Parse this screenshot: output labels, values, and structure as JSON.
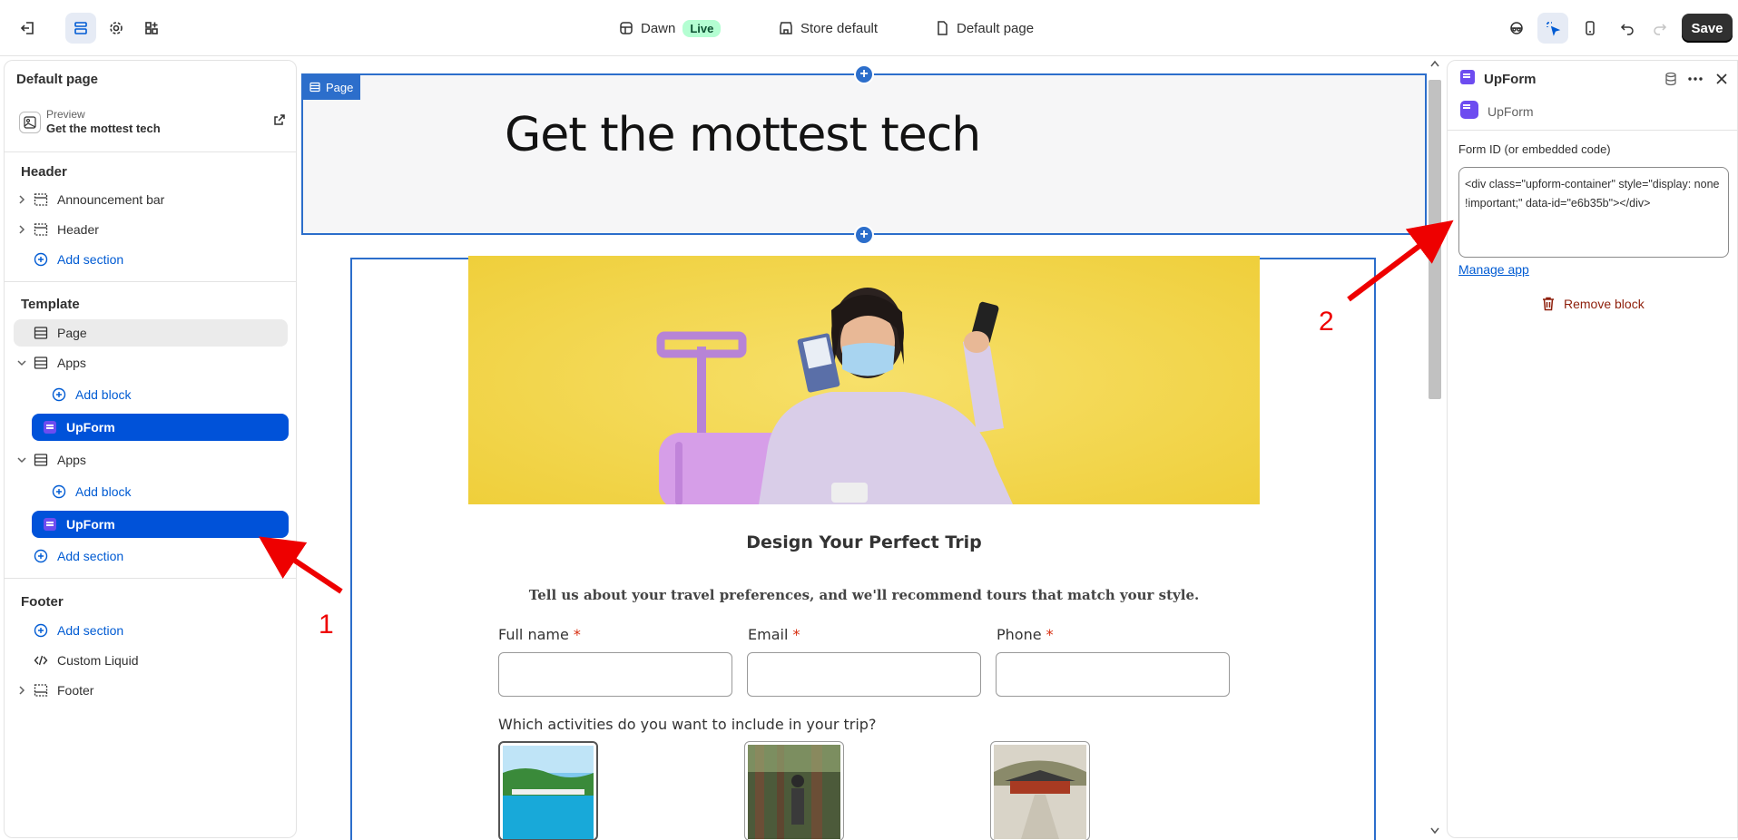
{
  "topbar": {
    "theme_name": "Dawn",
    "theme_status": "Live",
    "store": "Store default",
    "template": "Default page",
    "save_label": "Save"
  },
  "left_panel": {
    "title": "Default page",
    "preview_label": "Preview",
    "preview_value": "Get the mottest tech",
    "header_group": "Header",
    "header_items": [
      "Announcement bar",
      "Header"
    ],
    "add_section": "Add section",
    "template_group": "Template",
    "page_item": "Page",
    "apps_label": "Apps",
    "add_block": "Add block",
    "upform_label": "UpForm",
    "footer_group": "Footer",
    "custom_liquid": "Custom Liquid",
    "footer_item": "Footer"
  },
  "canvas": {
    "page_tag": "Page",
    "hero_title": "Get the mottest tech",
    "form_title": "Design Your Perfect Trip",
    "form_subtitle": "Tell us about your travel preferences, and we'll recommend tours that match your style.",
    "fields": [
      {
        "label": "Full name",
        "required": "*"
      },
      {
        "label": "Email",
        "required": "*"
      },
      {
        "label": "Phone",
        "required": "*"
      }
    ],
    "activities_question": "Which activities do you want to include in your trip?"
  },
  "right_panel": {
    "title": "UpForm",
    "app_name": "UpForm",
    "field_label": "Form ID (or embedded code)",
    "field_value": "<div class=\"upform-container\" style=\"display: none !important;\" data-id=\"e6b35b\"></div>",
    "manage_link": "Manage app",
    "remove_label": "Remove block"
  },
  "annotations": {
    "one": "1",
    "two": "2"
  },
  "colors": {
    "accent": "#2c6ecb",
    "selected_block": "#0052d9",
    "upform_brand": "#6d4cf0",
    "annotation": "#e00000"
  }
}
